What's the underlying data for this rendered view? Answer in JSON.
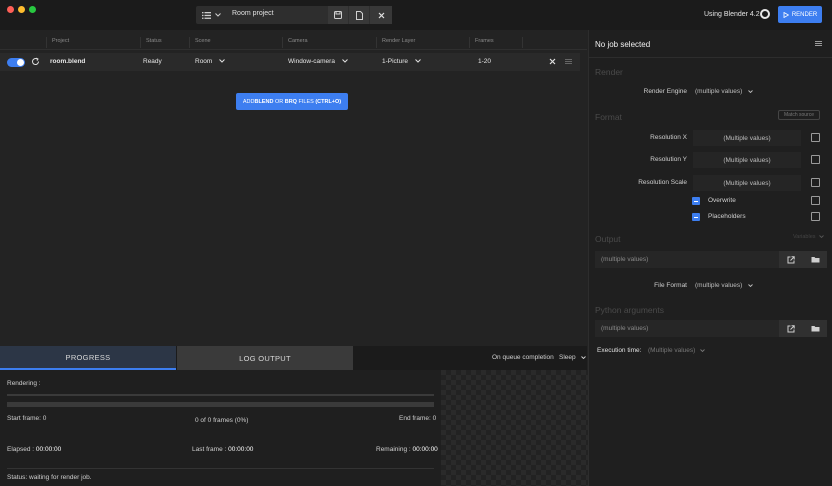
{
  "titlebar": {
    "project_name": "Room project",
    "using_label": "Using Blender 4.2",
    "render_label": "RENDER"
  },
  "table": {
    "headers": [
      "Project",
      "Status",
      "Scene",
      "Camera",
      "Render Layer",
      "Frames"
    ],
    "row": {
      "project": "room.blend",
      "status": "Ready",
      "scene": "Room",
      "camera": "Window-camera",
      "render_layer": "1-Picture",
      "frames": "1-20"
    },
    "add_button": {
      "pre": "ADD ",
      "blend": "BLEND",
      "mid": " OR ",
      "brq": "BRQ",
      "post": " FILES ",
      "shortcut": "(CTRL+O)"
    }
  },
  "panel": {
    "title": "No job selected",
    "render_section": "Render",
    "render_engine_label": "Render Engine",
    "render_engine_value": "(multiple values)",
    "match_source_label": "Match source",
    "format_section": "Format",
    "resolution_x_label": "Resolution X",
    "resolution_x_value": "(Multiple values)",
    "resolution_y_label": "Resolution Y",
    "resolution_y_value": "(Multiple values)",
    "resolution_scale_label": "Resolution Scale",
    "resolution_scale_value": "(Multiple values)",
    "overwrite_label": "Overwrite",
    "placeholders_label": "Placeholders",
    "output_section": "Output",
    "output_extra": "Variables",
    "output_path": "(multiple values)",
    "file_format_label": "File Format",
    "file_format_value": "(multiple values)",
    "python_section": "Python arguments",
    "python_value": "(multiple values)",
    "execution_time_label": "Execution time:",
    "execution_time_value": "(Multiple values)"
  },
  "bottom": {
    "tab_progress": "PROGRESS",
    "tab_log": "LOG OUTPUT",
    "queue_label": "On queue completion",
    "queue_value": "Sleep",
    "rendering_label": "Rendering :",
    "start_frame": "Start frame: 0",
    "frames_count": "0 of 0 frames (0%)",
    "end_frame": "End frame: 0",
    "elapsed_label": "Elapsed : ",
    "elapsed_value": "00:00:00",
    "last_frame_label": "Last frame : ",
    "last_frame_value": "00:00:00",
    "remaining_label": "Remaining : ",
    "remaining_value": "00:00:00",
    "status_text": "Status: waiting for render job."
  },
  "colors": {
    "accent": "#3d7ef0",
    "background": "#232323",
    "panel": "#1f1f1f"
  },
  "icons": [
    "menu-icon",
    "chevron-down-icon",
    "save-icon",
    "file-icon",
    "close-icon",
    "blender-icon",
    "play-icon",
    "refresh-icon",
    "drag-handle-icon",
    "hamburger-icon",
    "open-external-icon",
    "folder-icon"
  ]
}
